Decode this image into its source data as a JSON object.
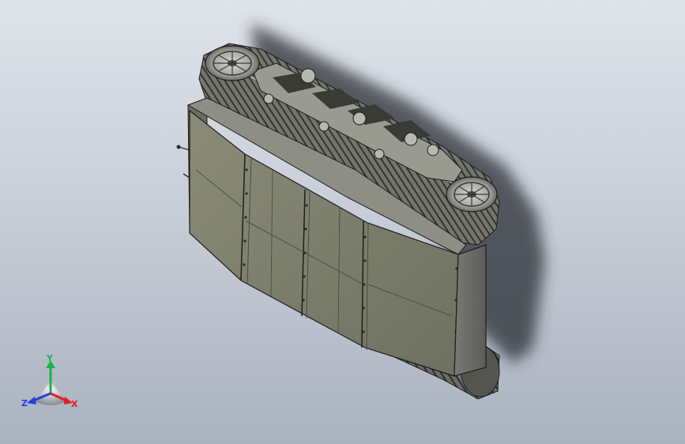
{
  "viewport": {
    "background_top": "#dfe3ea",
    "background_bottom": "#aab2bf"
  },
  "model": {
    "hull_color": "#7d7f6c",
    "hull_dark": "#5f6152",
    "track_color": "#6a6a64",
    "track_dark": "#3c3c38",
    "shadow_color": "#2b2e34",
    "edge_color": "#1e1f1c"
  },
  "triad": {
    "x_label": "X",
    "y_label": "Y",
    "z_label": "Z",
    "x_color": "#e02020",
    "y_color": "#19b34a",
    "z_color": "#2540d8"
  }
}
